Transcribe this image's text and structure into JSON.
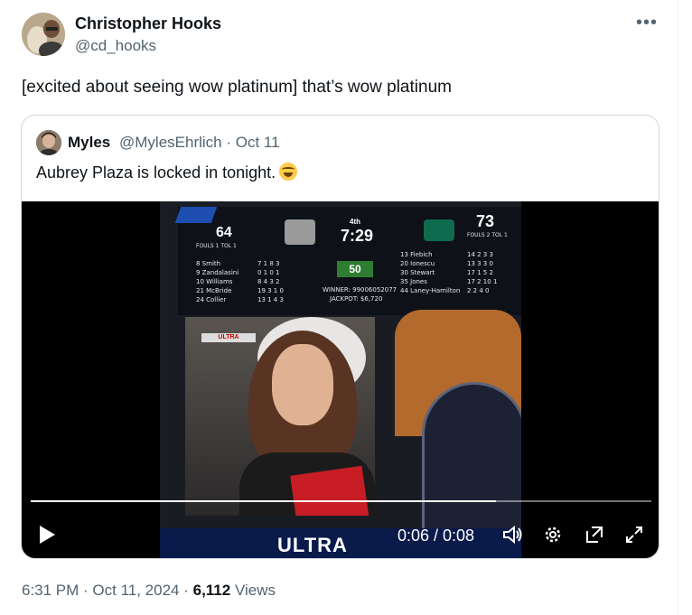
{
  "author": {
    "name": "Christopher Hooks",
    "handle": "@cd_hooks"
  },
  "tweet_text": "[excited about seeing wow platinum] that’s wow platinum",
  "quote": {
    "name": "Myles",
    "handle_date": "@MylesEhrlich · Oct 11",
    "text": "Aubrey Plaza is locked in tonight."
  },
  "video": {
    "time": "0:06 / 0:08",
    "progress": 0.75,
    "scoreboard": {
      "home_score": "64",
      "away_score": "73",
      "period": "4th",
      "clock": "7:29",
      "home_fouls": "FOULS 1   TOL 1",
      "away_fouls": "FOULS 2   TOL 1",
      "home_players": [
        "8 Smith",
        "9 Zandalasini",
        "10 Williams",
        "21 McBride",
        "24 Collier"
      ],
      "home_stats": [
        "7  1  8  3",
        "0  1  0  1",
        "8  4  3  2",
        "19 3  1  0",
        "13 1  4  3"
      ],
      "away_players": [
        "13 Fiebich",
        "20 Ionescu",
        "30 Stewart",
        "35 Jones",
        "44 Laney-Hamilton"
      ],
      "away_stats": [
        "14 2  3  3",
        "13 3  3  0",
        "17 1  5  2",
        "17 2 10  1",
        "2  2  4  0"
      ],
      "center_banner": "50",
      "winner": "WINNER: 99006052077",
      "jackpot": "JACKPOT: $6,720",
      "ad_text": "ULTRA"
    }
  },
  "footer": {
    "time_date": "6:31 PM · Oct 11, 2024 · ",
    "views_count": "6,112",
    "views_label": " Views"
  },
  "colors": {
    "handle_gray": "#536471",
    "border": "#cfd9de"
  }
}
